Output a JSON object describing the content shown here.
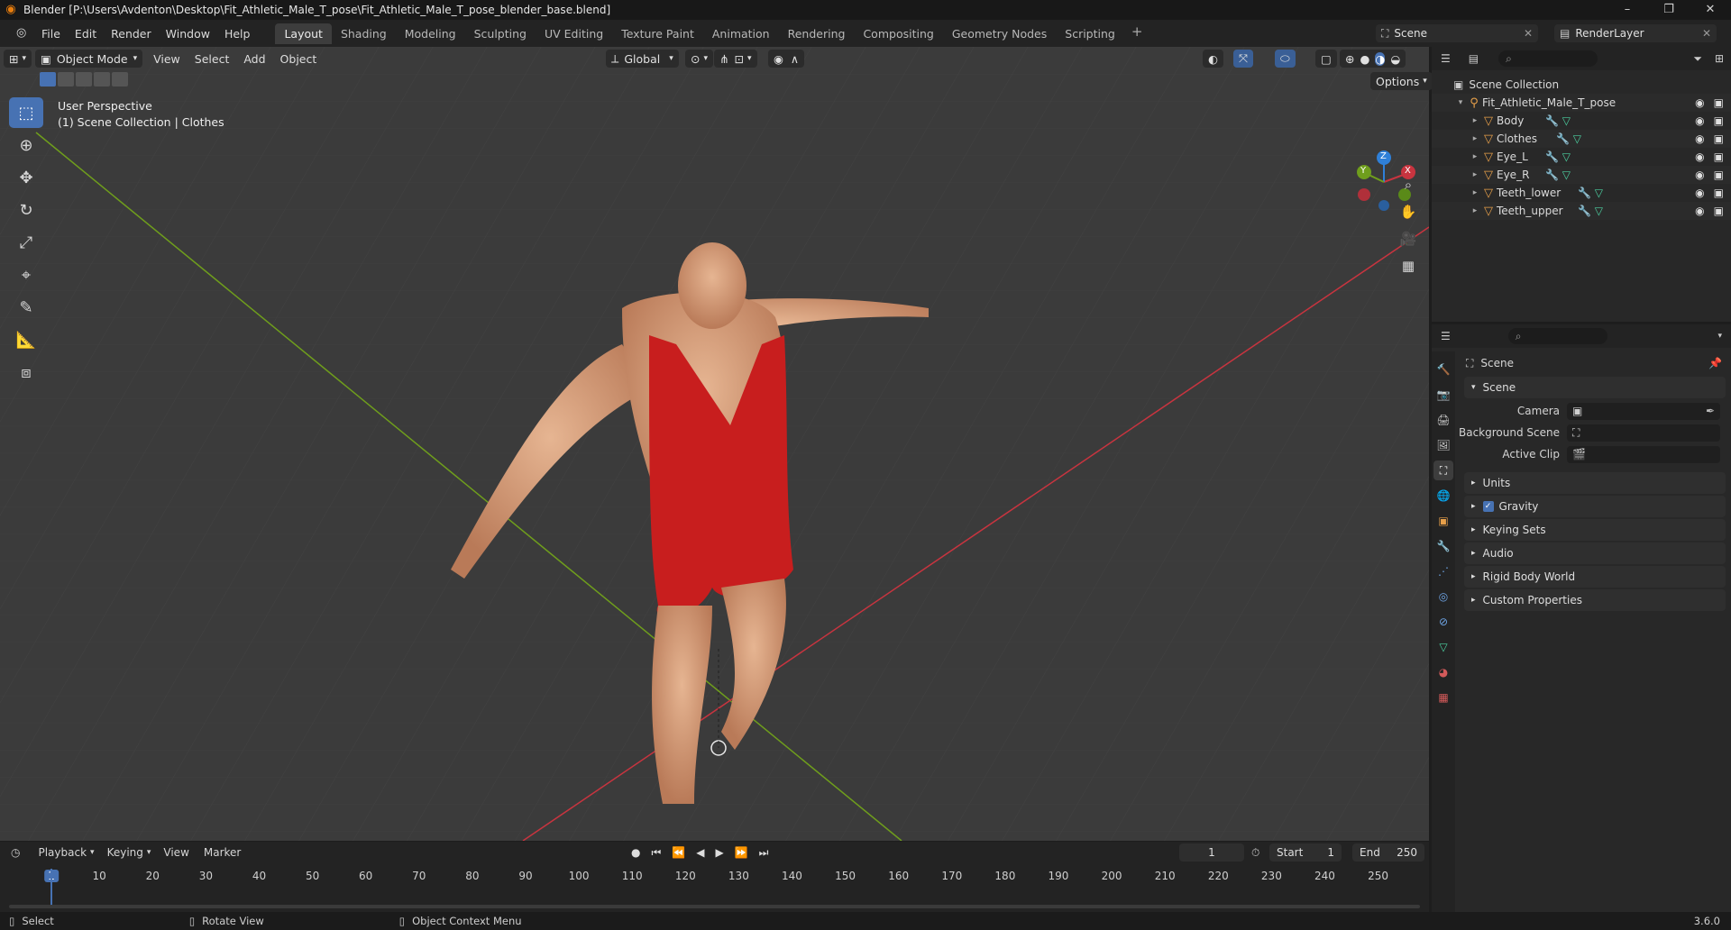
{
  "window": {
    "title": "Blender [P:\\Users\\Avdenton\\Desktop\\Fit_Athletic_Male_T_pose\\Fit_Athletic_Male_T_pose_blender_base.blend]",
    "minimize": "–",
    "maximize": "❐",
    "close": "✕"
  },
  "menu": [
    "File",
    "Edit",
    "Render",
    "Window",
    "Help"
  ],
  "workspaces": [
    "Layout",
    "Shading",
    "Modeling",
    "Sculpting",
    "UV Editing",
    "Texture Paint",
    "Animation",
    "Rendering",
    "Compositing",
    "Geometry Nodes",
    "Scripting"
  ],
  "workspace_add": "+",
  "scene_selector": "Scene",
  "view_layer": "RenderLayer",
  "viewport": {
    "mode": "Object Mode",
    "menus": [
      "View",
      "Select",
      "Add",
      "Object"
    ],
    "transform_orientation": "Global",
    "options_label": "Options",
    "perspective": "User Perspective",
    "context": "(1) Scene Collection | Clothes",
    "gizmo": {
      "x": "X",
      "y": "Y",
      "z": "Z"
    }
  },
  "outliner": {
    "root": "Scene Collection",
    "collection": "Fit_Athletic_Male_T_pose",
    "objects": [
      "Body",
      "Clothes",
      "Eye_L",
      "Eye_R",
      "Teeth_lower",
      "Teeth_upper"
    ]
  },
  "properties": {
    "context_title": "Scene",
    "panel_scene": "Scene",
    "fields": [
      {
        "label": "Camera",
        "value": ""
      },
      {
        "label": "Background Scene",
        "value": ""
      },
      {
        "label": "Active Clip",
        "value": ""
      }
    ],
    "subpanels": [
      "Units",
      "Gravity",
      "Keying Sets",
      "Audio",
      "Rigid Body World",
      "Custom Properties"
    ]
  },
  "timeline": {
    "menus": [
      "Playback",
      "Keying",
      "View",
      "Marker"
    ],
    "current_frame": "1",
    "start_label": "Start",
    "start": "1",
    "end_label": "End",
    "end": "250",
    "ticks": [
      "1",
      "10",
      "20",
      "30",
      "40",
      "50",
      "60",
      "70",
      "80",
      "90",
      "100",
      "110",
      "120",
      "130",
      "140",
      "150",
      "160",
      "170",
      "180",
      "190",
      "200",
      "210",
      "220",
      "230",
      "240",
      "250"
    ]
  },
  "statusbar": {
    "select": "Select",
    "rotate": "Rotate View",
    "context_menu": "Object Context Menu",
    "version": "3.6.0"
  },
  "colors": {
    "accent": "#4772b3",
    "x_axis": "#c8343f",
    "y_axis": "#6f9e1c",
    "suit": "#c81e1e",
    "skin": "#d9a07a"
  }
}
